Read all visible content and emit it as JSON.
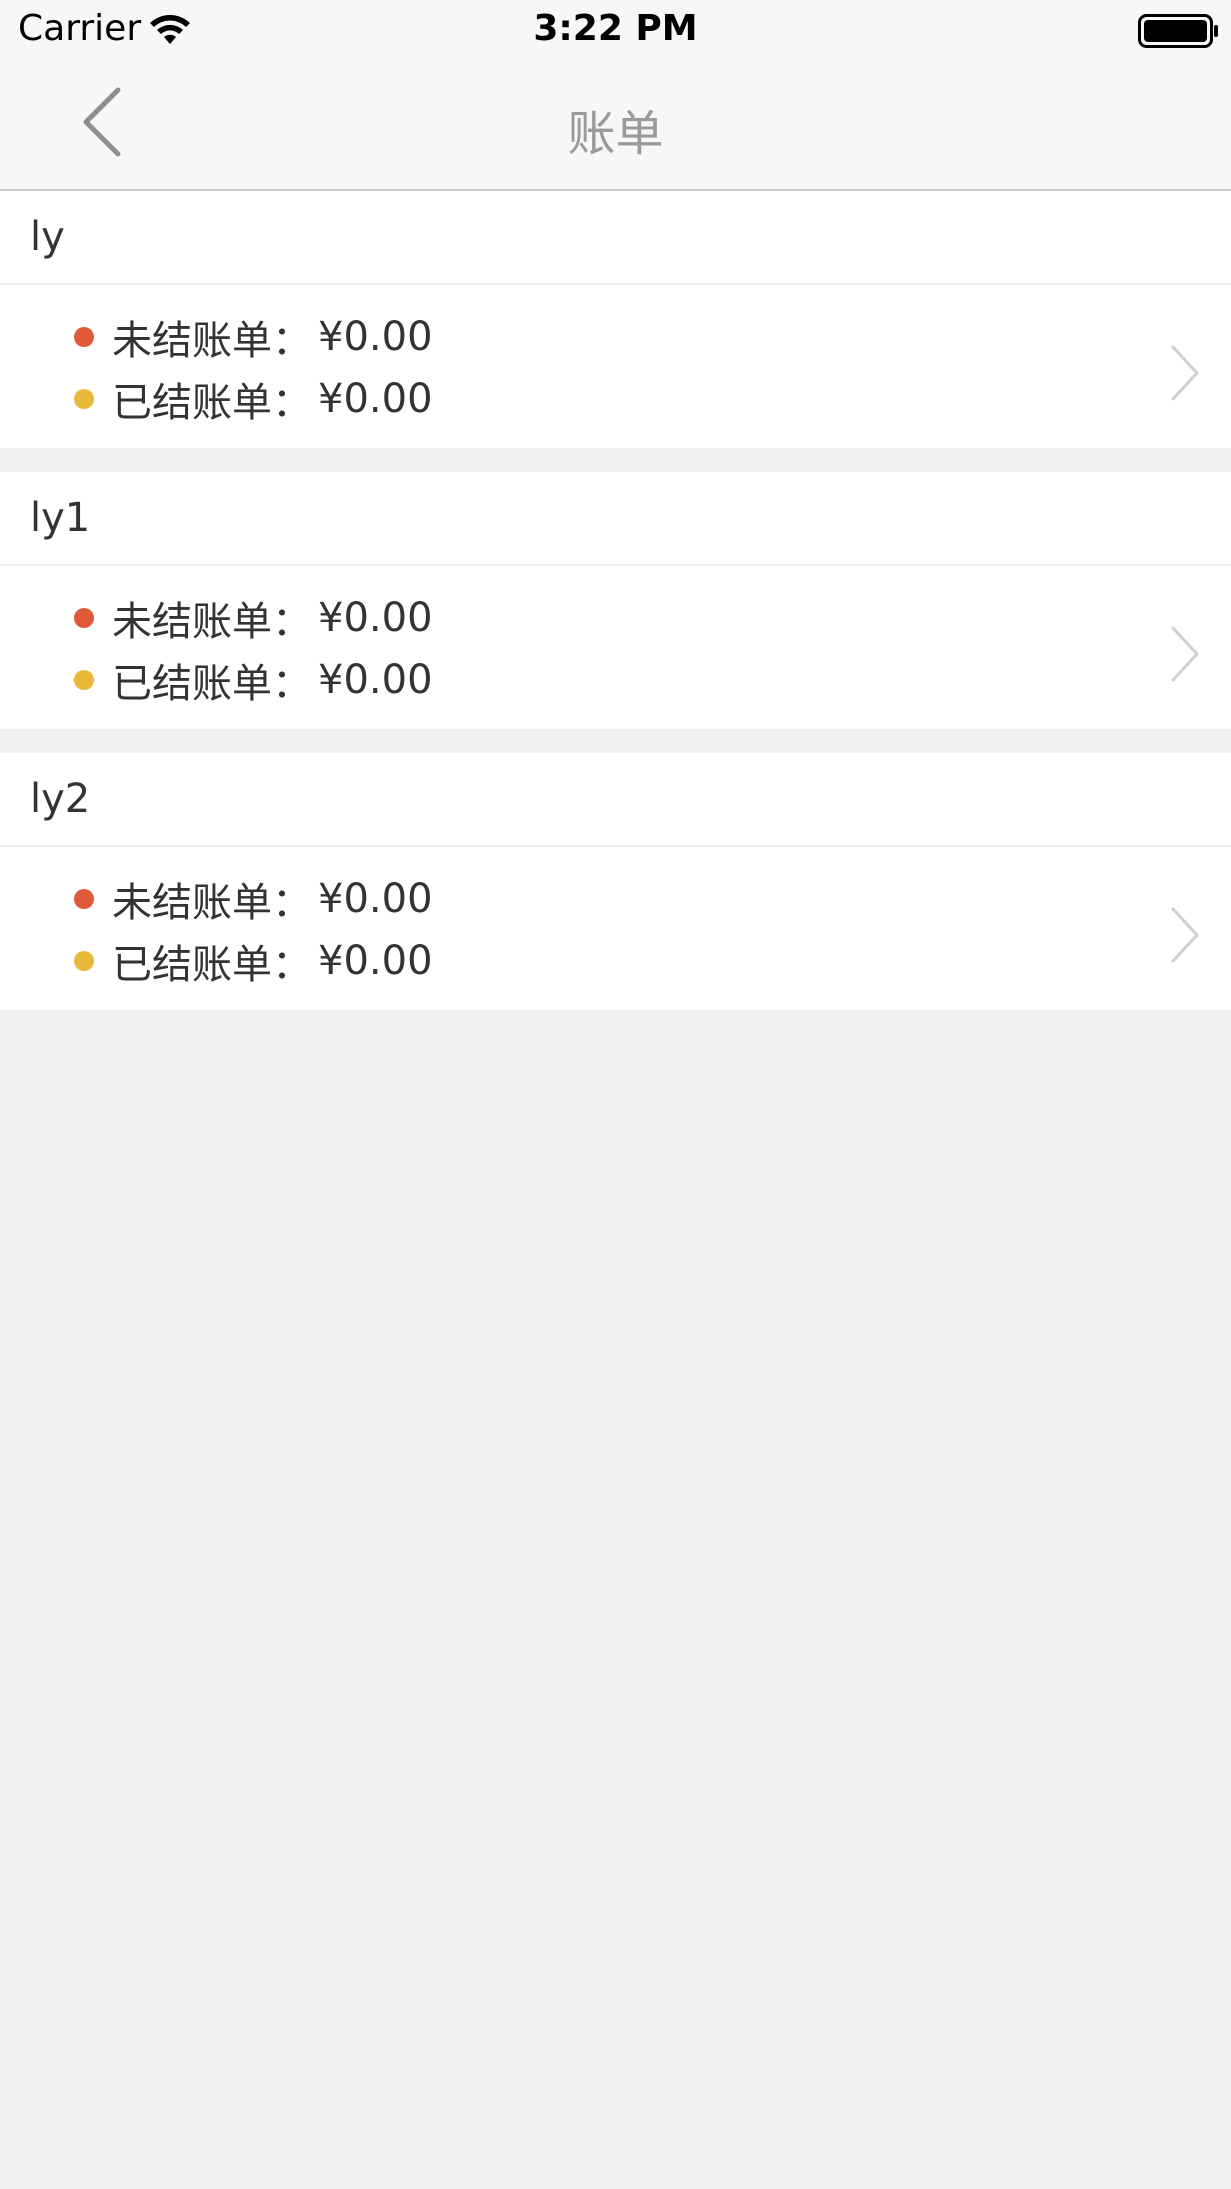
{
  "status_bar": {
    "carrier": "Carrier",
    "time": "3:22 PM",
    "wifi_icon": "wifi-icon",
    "battery_icon": "battery-icon"
  },
  "nav": {
    "back_icon": "chevron-left-icon",
    "title": "账单"
  },
  "colors": {
    "unsettled_dot": "#e05a3a",
    "settled_dot": "#e9b93a",
    "background": "#efefef"
  },
  "accounts": [
    {
      "name": "ly",
      "unsettled_label": "未结账单：",
      "unsettled_amount": "¥0.00",
      "settled_label": "已结账单：",
      "settled_amount": "¥0.00"
    },
    {
      "name": "ly1",
      "unsettled_label": "未结账单：",
      "unsettled_amount": "¥0.00",
      "settled_label": "已结账单：",
      "settled_amount": "¥0.00"
    },
    {
      "name": "ly2",
      "unsettled_label": "未结账单：",
      "unsettled_amount": "¥0.00",
      "settled_label": "已结账单：",
      "settled_amount": "¥0.00"
    }
  ]
}
